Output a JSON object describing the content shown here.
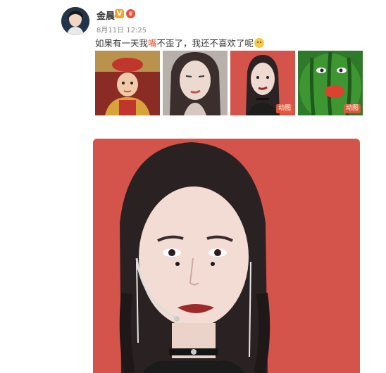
{
  "post": {
    "username": "金晨",
    "verified_badge": "V",
    "member_badge": "♛",
    "timestamp": "8月11日 12:25",
    "text_before": "如果有一天我",
    "text_highlight": "嘴",
    "text_after": "不歪了，我还不喜欢了呢",
    "emoji": "smirk-emoji"
  },
  "thumbnails": [
    {
      "name": "childhood-photo",
      "tag": ""
    },
    {
      "name": "face-closeup-1",
      "tag": ""
    },
    {
      "name": "stage-photo",
      "tag": "动图"
    },
    {
      "name": "watermelon-face",
      "tag": "动图"
    }
  ],
  "colors": {
    "accent": "#e8503a",
    "stage_bg": "#d4534b",
    "badge_orange": "#f5a623"
  }
}
